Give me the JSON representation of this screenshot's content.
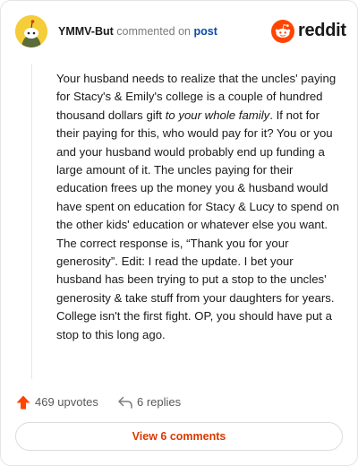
{
  "header": {
    "username": "YMMV-But",
    "commented_on": "commented on",
    "post_link": "post",
    "brand": "reddit"
  },
  "comment": {
    "part1": "Your husband needs to realize that the uncles' paying for Stacy's & Emily's college is a couple of hundred thousand dollars gift ",
    "emphasis": "to your whole family",
    "part2": ". If not for their paying for this, who would pay for it? You or you and your husband would probably end up funding a large amount of it. The uncles paying for their education frees up the money you & husband would have spent on education for Stacy & Lucy to spend on the other kids' education or whatever else you want. The correct response is, “Thank you for your generosity”. Edit: I read the update. I bet your husband has been trying to put a stop to the uncles' generosity & take stuff from your daughters for years. College isn't the first fight. OP, you should have put a stop to this long ago."
  },
  "actions": {
    "upvotes": "469 upvotes",
    "replies": "6 replies"
  },
  "footer": {
    "view_comments": "View 6 comments"
  },
  "colors": {
    "accent": "#d93a00",
    "upvote": "#ff4500",
    "link": "#0a4ba8",
    "avatar_bg": "#f5cc3a"
  },
  "icons": {
    "avatar": "snoo-avatar",
    "logo": "reddit-logo-icon",
    "upvote": "upvote-arrow-icon",
    "reply": "reply-arrow-icon"
  }
}
